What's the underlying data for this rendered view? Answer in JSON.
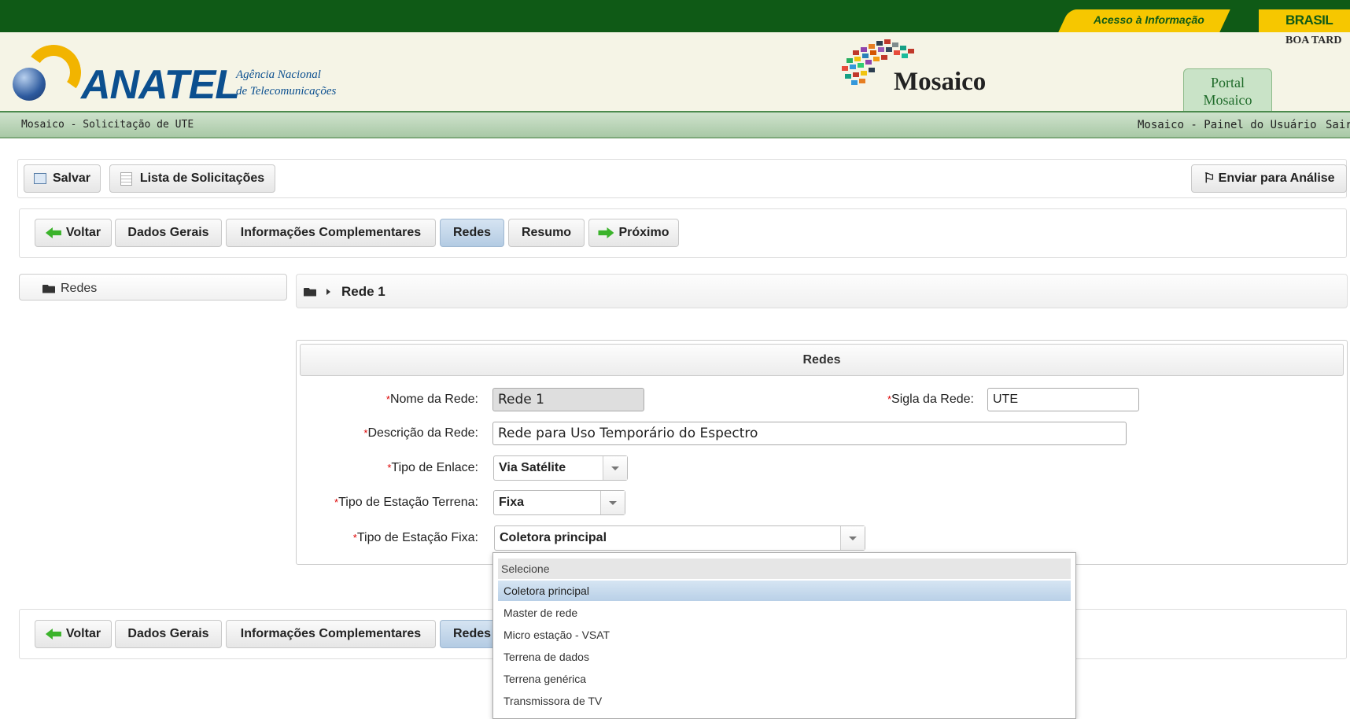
{
  "header": {
    "acesso": "Acesso à Informação",
    "brasil": "BRASIL",
    "greeting": "BOA TARD",
    "org_name": "ANATEL",
    "org_subtitle_1": "Agência Nacional",
    "org_subtitle_2": "de Telecomunicações",
    "app_name": "Mosaico",
    "portal_line1": "Portal",
    "portal_line2": "Mosaico"
  },
  "nav": {
    "breadcrumb": "Mosaico - Solicitação de UTE",
    "painel": "Mosaico - Painel do Usuário",
    "sair": "Sair"
  },
  "toolbar": {
    "save": "Salvar",
    "list": "Lista de Solicitações",
    "send": "Enviar para Análise"
  },
  "steps": {
    "back": "Voltar",
    "dados": "Dados Gerais",
    "info": "Informações Complementares",
    "redes": "Redes",
    "resumo": "Resumo",
    "next": "Próximo"
  },
  "tree": {
    "root": "Redes"
  },
  "crumb": {
    "current": "Rede 1"
  },
  "form": {
    "title": "Redes",
    "required_mark": "*",
    "nome_label": "Nome da Rede:",
    "nome_value": "Rede 1",
    "sigla_label": "Sigla da Rede:",
    "sigla_value": "UTE",
    "descricao_label": "Descrição da Rede:",
    "descricao_value": "Rede para Uso Temporário do Espectro",
    "enlace_label": "Tipo de Enlace:",
    "enlace_value": "Via Satélite",
    "terrena_label": "Tipo de Estação Terrena:",
    "terrena_value": "Fixa",
    "fixa_label": "Tipo de Estação Fixa:",
    "fixa_value": "Coletora principal"
  },
  "dropdown": {
    "placeholder": "Selecione",
    "options": [
      "Coletora principal",
      "Master de rede",
      "Micro estação - VSAT",
      "Terrena de dados",
      "Terrena genérica",
      "Transmissora de TV"
    ],
    "selected": "Coletora principal"
  },
  "colors": {
    "gov_green": "#0f5a16",
    "gov_yellow": "#f6c700",
    "anatel_blue": "#0b4f8f",
    "active_tab": "#b3cbe3"
  }
}
